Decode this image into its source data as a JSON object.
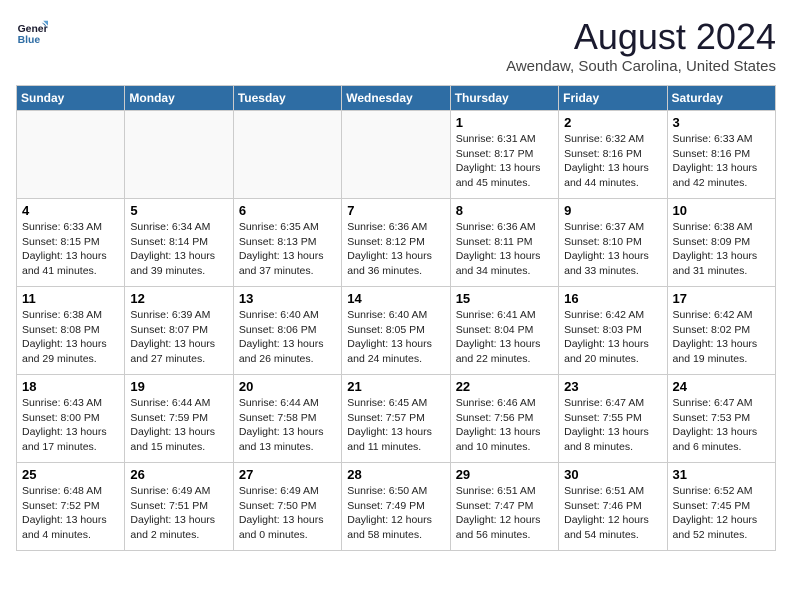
{
  "logo": {
    "line1": "General",
    "line2": "Blue"
  },
  "title": "August 2024",
  "location": "Awendaw, South Carolina, United States",
  "weekdays": [
    "Sunday",
    "Monday",
    "Tuesday",
    "Wednesday",
    "Thursday",
    "Friday",
    "Saturday"
  ],
  "weeks": [
    [
      {
        "day": "",
        "info": ""
      },
      {
        "day": "",
        "info": ""
      },
      {
        "day": "",
        "info": ""
      },
      {
        "day": "",
        "info": ""
      },
      {
        "day": "1",
        "info": "Sunrise: 6:31 AM\nSunset: 8:17 PM\nDaylight: 13 hours\nand 45 minutes."
      },
      {
        "day": "2",
        "info": "Sunrise: 6:32 AM\nSunset: 8:16 PM\nDaylight: 13 hours\nand 44 minutes."
      },
      {
        "day": "3",
        "info": "Sunrise: 6:33 AM\nSunset: 8:16 PM\nDaylight: 13 hours\nand 42 minutes."
      }
    ],
    [
      {
        "day": "4",
        "info": "Sunrise: 6:33 AM\nSunset: 8:15 PM\nDaylight: 13 hours\nand 41 minutes."
      },
      {
        "day": "5",
        "info": "Sunrise: 6:34 AM\nSunset: 8:14 PM\nDaylight: 13 hours\nand 39 minutes."
      },
      {
        "day": "6",
        "info": "Sunrise: 6:35 AM\nSunset: 8:13 PM\nDaylight: 13 hours\nand 37 minutes."
      },
      {
        "day": "7",
        "info": "Sunrise: 6:36 AM\nSunset: 8:12 PM\nDaylight: 13 hours\nand 36 minutes."
      },
      {
        "day": "8",
        "info": "Sunrise: 6:36 AM\nSunset: 8:11 PM\nDaylight: 13 hours\nand 34 minutes."
      },
      {
        "day": "9",
        "info": "Sunrise: 6:37 AM\nSunset: 8:10 PM\nDaylight: 13 hours\nand 33 minutes."
      },
      {
        "day": "10",
        "info": "Sunrise: 6:38 AM\nSunset: 8:09 PM\nDaylight: 13 hours\nand 31 minutes."
      }
    ],
    [
      {
        "day": "11",
        "info": "Sunrise: 6:38 AM\nSunset: 8:08 PM\nDaylight: 13 hours\nand 29 minutes."
      },
      {
        "day": "12",
        "info": "Sunrise: 6:39 AM\nSunset: 8:07 PM\nDaylight: 13 hours\nand 27 minutes."
      },
      {
        "day": "13",
        "info": "Sunrise: 6:40 AM\nSunset: 8:06 PM\nDaylight: 13 hours\nand 26 minutes."
      },
      {
        "day": "14",
        "info": "Sunrise: 6:40 AM\nSunset: 8:05 PM\nDaylight: 13 hours\nand 24 minutes."
      },
      {
        "day": "15",
        "info": "Sunrise: 6:41 AM\nSunset: 8:04 PM\nDaylight: 13 hours\nand 22 minutes."
      },
      {
        "day": "16",
        "info": "Sunrise: 6:42 AM\nSunset: 8:03 PM\nDaylight: 13 hours\nand 20 minutes."
      },
      {
        "day": "17",
        "info": "Sunrise: 6:42 AM\nSunset: 8:02 PM\nDaylight: 13 hours\nand 19 minutes."
      }
    ],
    [
      {
        "day": "18",
        "info": "Sunrise: 6:43 AM\nSunset: 8:00 PM\nDaylight: 13 hours\nand 17 minutes."
      },
      {
        "day": "19",
        "info": "Sunrise: 6:44 AM\nSunset: 7:59 PM\nDaylight: 13 hours\nand 15 minutes."
      },
      {
        "day": "20",
        "info": "Sunrise: 6:44 AM\nSunset: 7:58 PM\nDaylight: 13 hours\nand 13 minutes."
      },
      {
        "day": "21",
        "info": "Sunrise: 6:45 AM\nSunset: 7:57 PM\nDaylight: 13 hours\nand 11 minutes."
      },
      {
        "day": "22",
        "info": "Sunrise: 6:46 AM\nSunset: 7:56 PM\nDaylight: 13 hours\nand 10 minutes."
      },
      {
        "day": "23",
        "info": "Sunrise: 6:47 AM\nSunset: 7:55 PM\nDaylight: 13 hours\nand 8 minutes."
      },
      {
        "day": "24",
        "info": "Sunrise: 6:47 AM\nSunset: 7:53 PM\nDaylight: 13 hours\nand 6 minutes."
      }
    ],
    [
      {
        "day": "25",
        "info": "Sunrise: 6:48 AM\nSunset: 7:52 PM\nDaylight: 13 hours\nand 4 minutes."
      },
      {
        "day": "26",
        "info": "Sunrise: 6:49 AM\nSunset: 7:51 PM\nDaylight: 13 hours\nand 2 minutes."
      },
      {
        "day": "27",
        "info": "Sunrise: 6:49 AM\nSunset: 7:50 PM\nDaylight: 13 hours\nand 0 minutes."
      },
      {
        "day": "28",
        "info": "Sunrise: 6:50 AM\nSunset: 7:49 PM\nDaylight: 12 hours\nand 58 minutes."
      },
      {
        "day": "29",
        "info": "Sunrise: 6:51 AM\nSunset: 7:47 PM\nDaylight: 12 hours\nand 56 minutes."
      },
      {
        "day": "30",
        "info": "Sunrise: 6:51 AM\nSunset: 7:46 PM\nDaylight: 12 hours\nand 54 minutes."
      },
      {
        "day": "31",
        "info": "Sunrise: 6:52 AM\nSunset: 7:45 PM\nDaylight: 12 hours\nand 52 minutes."
      }
    ]
  ]
}
